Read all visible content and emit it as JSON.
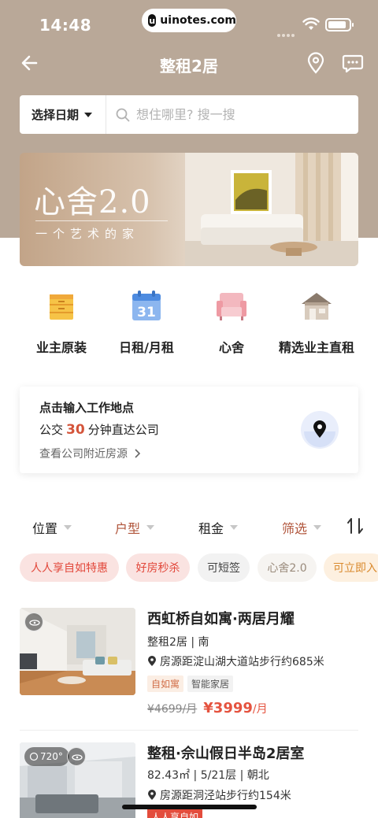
{
  "status_bar": {
    "time": "14:48",
    "url": "uinotes.com"
  },
  "nav": {
    "title": "整租2居"
  },
  "search": {
    "date_label": "选择日期",
    "placeholder": "想住哪里? 搜一搜"
  },
  "banner": {
    "title": "心舍2.0",
    "subtitle": "一个艺术的家"
  },
  "categories": [
    {
      "label": "业主原装",
      "icon": "cabinet-icon"
    },
    {
      "label": "日租/月租",
      "icon": "calendar-icon"
    },
    {
      "label": "心舍",
      "icon": "sofa-icon"
    },
    {
      "label": "精选业主直租",
      "icon": "house-icon"
    }
  ],
  "work_card": {
    "title": "点击输入工作地点",
    "commute_prefix": "公交",
    "commute_minutes": "30",
    "commute_suffix": "分钟直达公司",
    "link": "查看公司附近房源"
  },
  "filters": [
    {
      "label": "位置",
      "active": false
    },
    {
      "label": "户型",
      "active": true
    },
    {
      "label": "租金",
      "active": false
    },
    {
      "label": "筛选",
      "active": true
    }
  ],
  "tags": [
    {
      "label": "人人享自如特惠",
      "style": "red"
    },
    {
      "label": "好房秒杀",
      "style": "red"
    },
    {
      "label": "可短签",
      "style": "grey"
    },
    {
      "label": "心舍2.0",
      "style": "outline"
    },
    {
      "label": "可立即入",
      "style": "orange"
    }
  ],
  "listings": [
    {
      "title": "西虹桥自如寓·两居月耀",
      "meta": "整租2居 | 南",
      "distance": "房源距淀山湖大道站步行约685米",
      "chips": [
        "自如寓",
        "智能家居"
      ],
      "old_price": "¥4699/月",
      "price": "¥3999",
      "unit": "/月"
    },
    {
      "title": "整租·佘山假日半岛2居室",
      "meta": "82.43㎡ | 5/21层 | 朝北",
      "distance": "房源距洞泾站步行约154米",
      "chips": [
        "人人享自如"
      ],
      "badge": "720°"
    }
  ],
  "colors": {
    "brand_bg": "#b9a898",
    "accent": "#e5533f",
    "tag_red_bg": "#fae3e1"
  }
}
